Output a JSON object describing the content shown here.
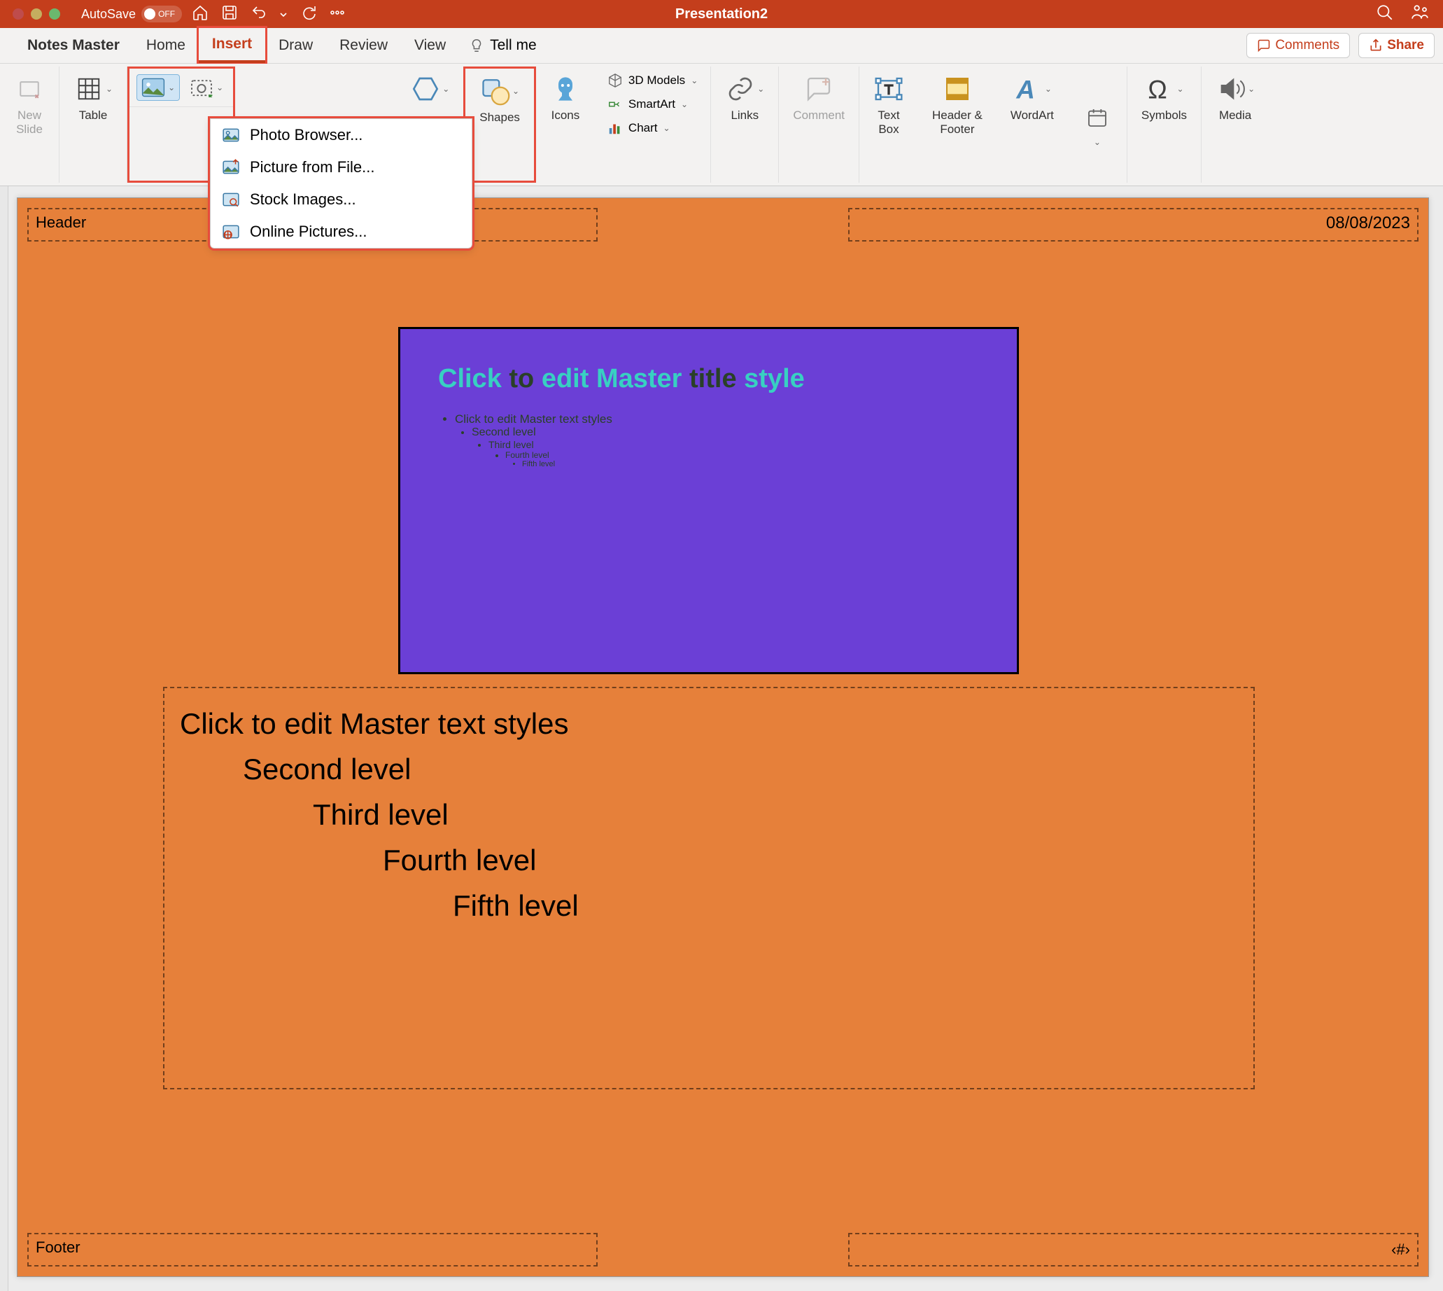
{
  "titlebar": {
    "autosave_label": "AutoSave",
    "autosave_state": "OFF",
    "document_title": "Presentation2"
  },
  "tabs": {
    "notes_master": "Notes Master",
    "home": "Home",
    "insert": "Insert",
    "draw": "Draw",
    "review": "Review",
    "view": "View",
    "tell_me": "Tell me"
  },
  "toolbar_right": {
    "comments": "Comments",
    "share": "Share"
  },
  "ribbon": {
    "new_slide": "New\nSlide",
    "table": "Table",
    "shapes": "Shapes",
    "icons": "Icons",
    "models3d": "3D Models",
    "smartart": "SmartArt",
    "chart": "Chart",
    "links": "Links",
    "comment": "Comment",
    "text_box": "Text\nBox",
    "header_footer": "Header &\nFooter",
    "wordart": "WordArt",
    "symbols": "Symbols",
    "media": "Media"
  },
  "pictures_menu": {
    "photo_browser": "Photo Browser...",
    "picture_from_file": "Picture from File...",
    "stock_images": "Stock Images...",
    "online_pictures": "Online Pictures..."
  },
  "notes_page": {
    "header": "Header",
    "date": "08/08/2023",
    "footer": "Footer",
    "slide_number_placeholder": "‹#›"
  },
  "slide_thumb": {
    "title_w1": "Click",
    "title_w2": "to",
    "title_w3": "edit",
    "title_w4": "Master",
    "title_w5": "title",
    "title_w6": "style",
    "bullets": {
      "l1": "Click to edit Master text styles",
      "l2": "Second level",
      "l3": "Third level",
      "l4": "Fourth level",
      "l5": "Fifth level"
    }
  },
  "body_levels": {
    "l1": "Click to edit Master text styles",
    "l2": "Second level",
    "l3": "Third level",
    "l4": "Fourth level",
    "l5": "Fifth level"
  }
}
